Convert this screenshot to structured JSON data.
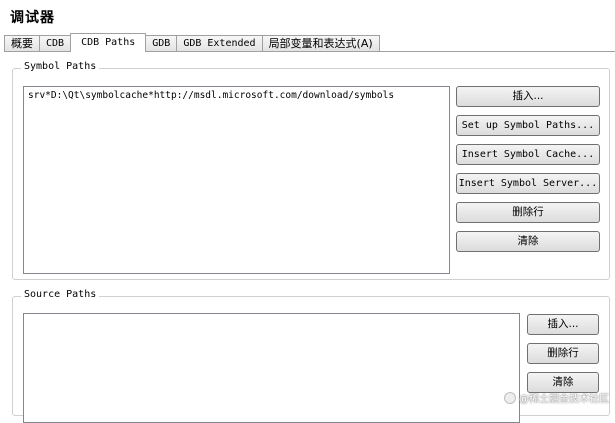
{
  "page": {
    "title": "调试器"
  },
  "tabs": [
    {
      "label": "概要",
      "active": false
    },
    {
      "label": "CDB",
      "active": false
    },
    {
      "label": "CDB Paths",
      "active": true
    },
    {
      "label": "GDB",
      "active": false
    },
    {
      "label": "GDB Extended",
      "active": false
    },
    {
      "label": "局部变量和表达式(A)",
      "active": false
    }
  ],
  "symbol_paths": {
    "title": "Symbol Paths",
    "items": [
      "srv*D:\\Qt\\symbolcache*http://msdl.microsoft.com/download/symbols"
    ],
    "buttons": {
      "insert": "插入...",
      "setup": "Set up Symbol Paths...",
      "insert_cache": "Insert Symbol Cache...",
      "insert_server": "Insert Symbol Server...",
      "delete_row": "删除行",
      "clear": "清除"
    }
  },
  "source_paths": {
    "title": "Source Paths",
    "items": [],
    "buttons": {
      "insert": "插入...",
      "delete_row": "删除行",
      "clear": "清除"
    }
  },
  "watermark": {
    "text": "@稀土掘金技术社区"
  }
}
